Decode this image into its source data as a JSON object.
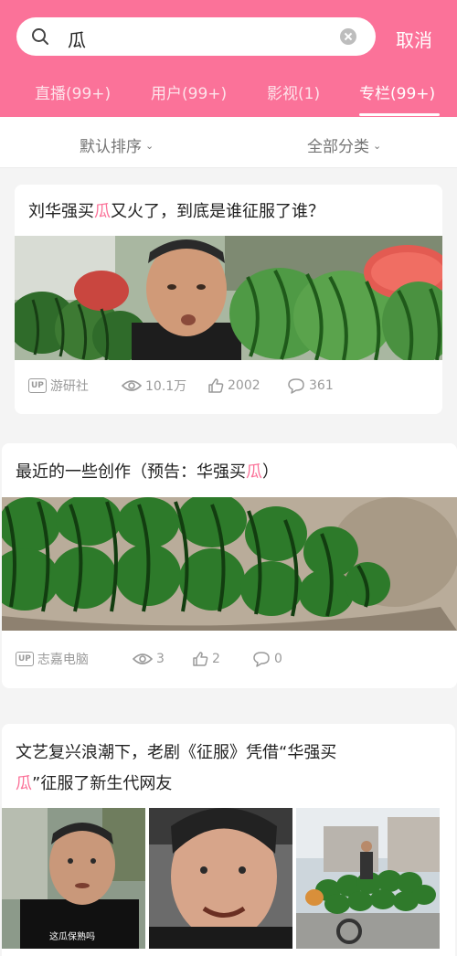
{
  "search": {
    "query": "瓜",
    "cancel_label": "取消"
  },
  "tabs": [
    {
      "label": "直播(99+)"
    },
    {
      "label": "用户(99+)"
    },
    {
      "label": "影视(1)"
    },
    {
      "label": "专栏(99+)"
    }
  ],
  "filters": {
    "sort_label": "默认排序",
    "category_label": "全部分类"
  },
  "articles": [
    {
      "title_before": "刘华强买",
      "title_hl": "瓜",
      "title_after": "又火了，到底是谁征服了谁？",
      "up_badge": "UP",
      "author": "游研社",
      "views": "10.1万",
      "likes": "2002",
      "comments": "361"
    },
    {
      "title_before": "最近的一些创作（预告：华强买",
      "title_hl": "瓜",
      "title_after": "）",
      "up_badge": "UP",
      "author": "志嘉电脑",
      "views": "3",
      "likes": "2",
      "comments": "0"
    },
    {
      "title_line1": "文艺复兴浪潮下，老剧《征服》凭借“华强买",
      "title_line2_hl": "瓜",
      "title_line2_after": "”征服了新生代网友",
      "image_caption": "这瓜保熟吗"
    }
  ],
  "colors": {
    "accent": "#fb7299",
    "meta": "#9a9a9a",
    "background": "#f4f4f4"
  }
}
